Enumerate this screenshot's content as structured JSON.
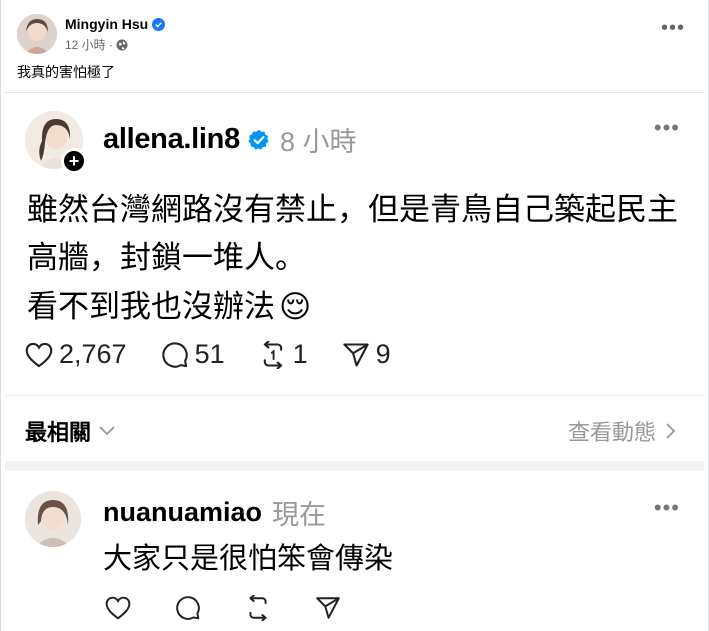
{
  "fb_post": {
    "author": "Mingyin Hsu",
    "verified_icon": "verified-badge-icon",
    "timestamp": "12 小時",
    "separator": "·",
    "privacy_icon": "globe-icon",
    "more_label": "•••",
    "caption": "我真的害怕極了"
  },
  "threads_post": {
    "username": "allena.lin8",
    "time": "8 小時",
    "more_label": "•••",
    "text": "雖然台灣網路沒有禁止，但是青鳥自己築起民主高牆，封鎖一堆人。",
    "text2": "看不到我也沒辦法",
    "emoji": "😌",
    "likes": "2,767",
    "comments": "51",
    "reposts": "1",
    "shares": "9",
    "follow_plus": "+"
  },
  "replies_bar": {
    "sort_label": "最相關",
    "activity_label": "查看動態"
  },
  "reply": {
    "username": "nuanuamiao",
    "time": "現在",
    "more_label": "•••",
    "text": "大家只是很怕笨會傳染"
  },
  "colors": {
    "threads_verified": "#0095f6",
    "fb_verified": "#1877f2",
    "muted": "#999999"
  }
}
